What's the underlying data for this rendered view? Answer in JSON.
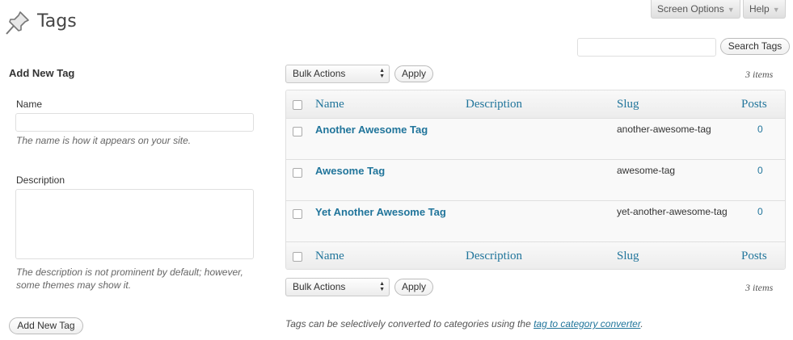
{
  "header": {
    "title": "Tags",
    "screen_options_label": "Screen Options",
    "help_label": "Help"
  },
  "search": {
    "value": "",
    "button_label": "Search Tags"
  },
  "add_form": {
    "section_title": "Add New Tag",
    "name_label": "Name",
    "name_value": "",
    "name_hint": "The name is how it appears on your site.",
    "description_label": "Description",
    "description_value": "",
    "description_hint_line1": "The description is not prominent by default; however,",
    "description_hint_line2": "some themes may show it.",
    "submit_label": "Add New Tag"
  },
  "list": {
    "bulk_top": {
      "selected": "Bulk Actions",
      "apply_label": "Apply"
    },
    "bulk_bottom": {
      "selected": "Bulk Actions",
      "apply_label": "Apply"
    },
    "items_count_top": "3 items",
    "items_count_bottom": "3 items",
    "columns": [
      "Name",
      "Description",
      "Slug",
      "Posts"
    ],
    "rows": [
      {
        "name": "Another Awesome Tag",
        "description": "",
        "slug": "another-awesome-tag",
        "posts": "0"
      },
      {
        "name": "Awesome Tag",
        "description": "",
        "slug": "awesome-tag",
        "posts": "0"
      },
      {
        "name": "Yet Another Awesome Tag",
        "description": "",
        "slug": "yet-another-awesome-tag",
        "posts": "0"
      }
    ]
  },
  "footer_note": {
    "prefix": "Tags can be selectively converted to categories using the ",
    "link_text": "tag to category converter",
    "suffix": "."
  },
  "icons": {
    "page_icon": "pushpin-icon",
    "dropdown": "dropdown-arrow-icon"
  },
  "colors": {
    "link": "#21759b",
    "border": "#dfdfdf",
    "header_text": "#464646"
  }
}
